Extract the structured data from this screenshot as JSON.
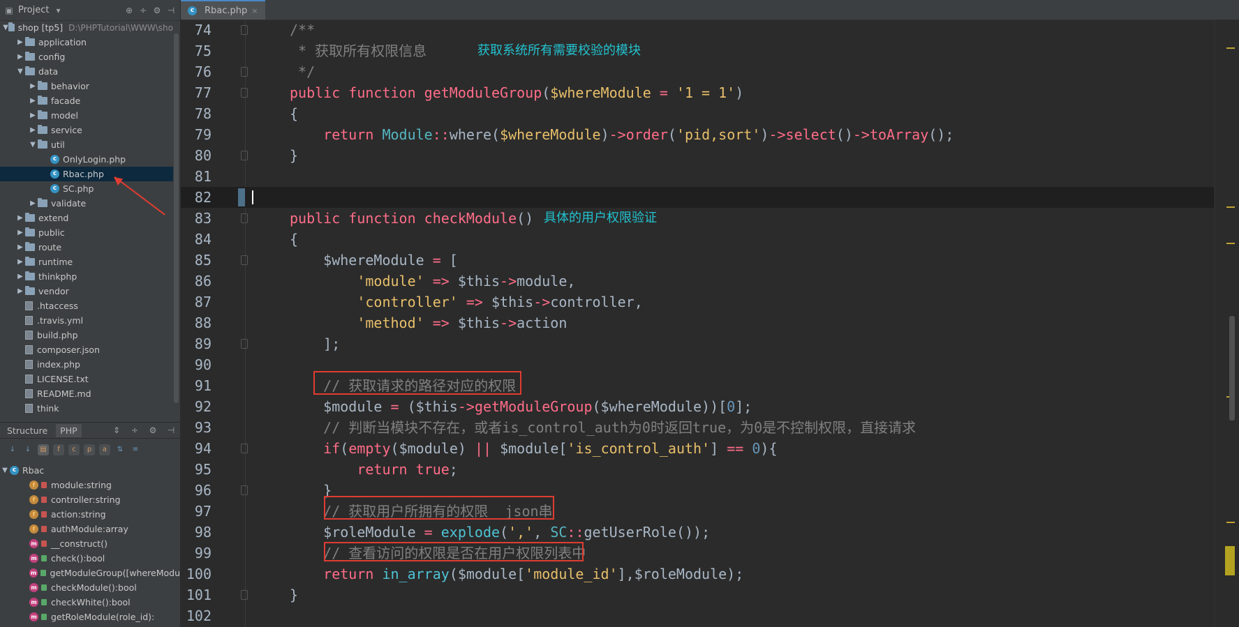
{
  "project_panel": {
    "title": "Project",
    "tree": [
      {
        "label": "shop [tp5]",
        "path": "D:\\PHPTutorial\\WWW\\sho",
        "depth": 0,
        "type": "root",
        "expanded": true
      },
      {
        "label": "application",
        "depth": 1,
        "type": "folder",
        "expanded": false
      },
      {
        "label": "config",
        "depth": 1,
        "type": "folder",
        "expanded": false
      },
      {
        "label": "data",
        "depth": 1,
        "type": "folder",
        "expanded": true
      },
      {
        "label": "behavior",
        "depth": 2,
        "type": "folder",
        "expanded": false
      },
      {
        "label": "facade",
        "depth": 2,
        "type": "folder",
        "expanded": false
      },
      {
        "label": "model",
        "depth": 2,
        "type": "folder",
        "expanded": false
      },
      {
        "label": "service",
        "depth": 2,
        "type": "folder",
        "expanded": false
      },
      {
        "label": "util",
        "depth": 2,
        "type": "folder",
        "expanded": true
      },
      {
        "label": "OnlyLogin.php",
        "depth": 3,
        "type": "class"
      },
      {
        "label": "Rbac.php",
        "depth": 3,
        "type": "class",
        "selected": true
      },
      {
        "label": "SC.php",
        "depth": 3,
        "type": "class"
      },
      {
        "label": "validate",
        "depth": 2,
        "type": "folder",
        "expanded": false
      },
      {
        "label": "extend",
        "depth": 1,
        "type": "folder",
        "expanded": false
      },
      {
        "label": "public",
        "depth": 1,
        "type": "folder",
        "expanded": false
      },
      {
        "label": "route",
        "depth": 1,
        "type": "folder",
        "expanded": false
      },
      {
        "label": "runtime",
        "depth": 1,
        "type": "folder",
        "expanded": false
      },
      {
        "label": "thinkphp",
        "depth": 1,
        "type": "folder",
        "expanded": false
      },
      {
        "label": "vendor",
        "depth": 1,
        "type": "folder",
        "expanded": false
      },
      {
        "label": ".htaccess",
        "depth": 1,
        "type": "file"
      },
      {
        "label": ".travis.yml",
        "depth": 1,
        "type": "file"
      },
      {
        "label": "build.php",
        "depth": 1,
        "type": "file"
      },
      {
        "label": "composer.json",
        "depth": 1,
        "type": "file"
      },
      {
        "label": "index.php",
        "depth": 1,
        "type": "file"
      },
      {
        "label": "LICENSE.txt",
        "depth": 1,
        "type": "file"
      },
      {
        "label": "README.md",
        "depth": 1,
        "type": "file"
      },
      {
        "label": "think",
        "depth": 1,
        "type": "file"
      }
    ]
  },
  "structure_panel": {
    "tab_structure": "Structure",
    "tab_php": "PHP",
    "root": "Rbac",
    "items": [
      {
        "kind": "f",
        "access": "private",
        "label": "module:string"
      },
      {
        "kind": "f",
        "access": "private",
        "label": "controller:string"
      },
      {
        "kind": "f",
        "access": "private",
        "label": "action:string"
      },
      {
        "kind": "f",
        "access": "private",
        "label": "authModule:array"
      },
      {
        "kind": "m",
        "access": "private",
        "label": "__construct()"
      },
      {
        "kind": "m",
        "access": "public",
        "label": "check():bool"
      },
      {
        "kind": "m",
        "access": "public",
        "label": "getModuleGroup([whereModu"
      },
      {
        "kind": "m",
        "access": "public",
        "label": "checkModule():bool"
      },
      {
        "kind": "m",
        "access": "public",
        "label": "checkWhite():bool"
      },
      {
        "kind": "m",
        "access": "public",
        "label": "getRoleModule(role_id):"
      }
    ]
  },
  "editor": {
    "tab_label": "Rbac.php",
    "current_line": 82,
    "annotations": {
      "l75": "获取系统所有需要校验的模块",
      "l83": "具体的用户权限验证"
    },
    "lines": {
      "l74": "/**",
      "l75a": " * 获取所有权限信息",
      "l76": " */",
      "l91": "// 获取请求的路径对应的权限",
      "l93": "// 判断当模块不存在，或者is_control_auth为0时返回true，为0是不控制权限，直接请求",
      "l97": "// 获取用户所拥有的权限  json串",
      "l99": "// 查看访问的权限是否在用户权限列表中"
    },
    "line_numbers": [
      74,
      75,
      76,
      77,
      78,
      79,
      80,
      81,
      82,
      83,
      84,
      85,
      86,
      87,
      88,
      89,
      90,
      91,
      92,
      93,
      94,
      95,
      96,
      97,
      98,
      99,
      100,
      101,
      102
    ]
  }
}
